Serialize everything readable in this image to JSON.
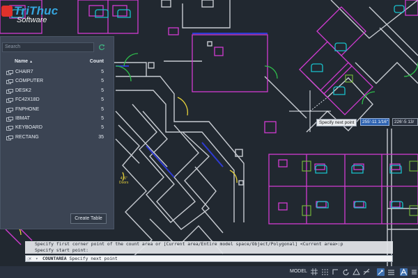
{
  "watermark": {
    "brand": "TriThuc",
    "sub": "Software"
  },
  "count_panel": {
    "search_placeholder": "Search",
    "col_name": "Name",
    "col_count": "Count",
    "rows": [
      {
        "name": "CHAIR7",
        "count": "5"
      },
      {
        "name": "COMPUTER",
        "count": "5"
      },
      {
        "name": "DESK2",
        "count": "5"
      },
      {
        "name": "FC42X18D",
        "count": "5"
      },
      {
        "name": "FNPHONE",
        "count": "5"
      },
      {
        "name": "IBMAT",
        "count": "5"
      },
      {
        "name": "KEYBOARD",
        "count": "5"
      },
      {
        "name": "RECTANG",
        "count": "35"
      }
    ],
    "create_table_label": "Create Table"
  },
  "cursor": {
    "tooltip": "Specify next point",
    "dim_input_1": "255'-11 1/16\"",
    "dim_input_2": "226'-5 13/"
  },
  "drawing": {
    "annotation_line1": "4'-6\"",
    "annotation_line2": "Doors"
  },
  "command": {
    "history_1": "Specify first corner point of the count area or [Current area/Entire model space/Object/Polygonal] <Current area>:p",
    "history_2": "Specify start point:",
    "prompt_command": "COUNTAREA",
    "prompt_text": "Specify next point"
  },
  "statusbar": {
    "model_label": "MODEL"
  },
  "colors": {
    "background": "#212830",
    "walls": "#c8ccd2",
    "furniture_magenta": "#d23bd2",
    "chairs_cyan": "#18c2cc",
    "doors_yellow": "#e6d23b",
    "door_swings_green": "#2fbe4c",
    "glazing_blue": "#2e3bd4",
    "panel_bg": "#3b4453",
    "input_highlight": "#2d62b0"
  },
  "icons": {
    "refresh": "refresh-icon",
    "block": "block-icon",
    "close": "close-icon",
    "wrench": "wrench-icon",
    "grid": "grid-icon"
  }
}
